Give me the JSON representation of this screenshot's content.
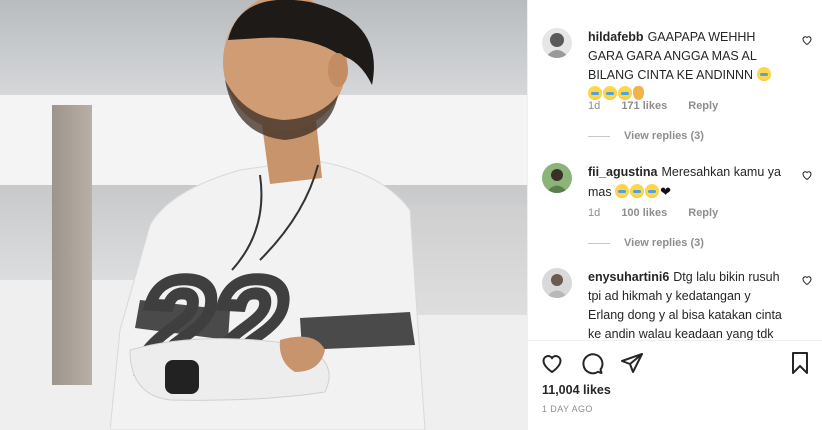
{
  "comments": [
    {
      "username": "hildafebb",
      "text": "GAAPAPA WEHHH GARA GARA ANGGA MAS AL BILANG CINTA KE ANDINNN",
      "emoji_icons": [
        "loudly-crying-face-icon",
        "loudly-crying-face-icon",
        "loudly-crying-face-icon",
        "loudly-crying-face-icon",
        "clapping-hands-icon"
      ],
      "time": "1d",
      "likes": "171 likes",
      "reply": "Reply",
      "view_replies": "View replies (3)"
    },
    {
      "username": "fii_agustina",
      "text": "Meresahkan kamu ya mas",
      "emoji_icons": [
        "loudly-crying-face-icon",
        "loudly-crying-face-icon",
        "loudly-crying-face-icon",
        "black-heart-icon"
      ],
      "time": "1d",
      "likes": "100 likes",
      "reply": "Reply",
      "view_replies": "View replies (3)"
    },
    {
      "username": "enysuhartini6",
      "text": "Dtg lalu bikin rusuh tpi ad hikmah y kedatangan y Erlang dong y al bisa katakan cinta ke andin walau keadaan yang tdk memungkinkan tpi sedih"
    }
  ],
  "actions": {
    "icons": [
      "heart-outline-icon",
      "comment-icon",
      "share-icon",
      "bookmark-icon"
    ]
  },
  "likes_count": "11,004 likes",
  "posted_ago": "1 DAY AGO",
  "colors": {
    "muted": "#8e8e8e",
    "text": "#262626",
    "divider": "#efefef"
  }
}
